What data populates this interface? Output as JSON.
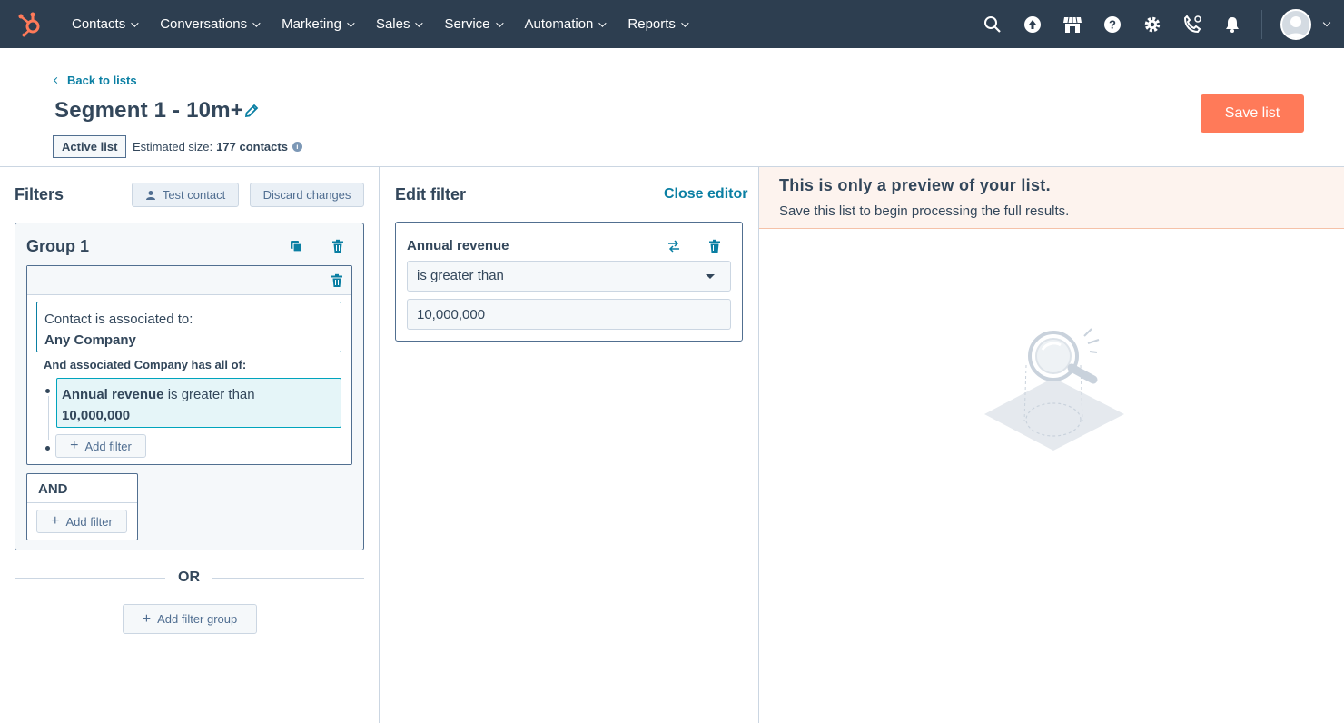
{
  "nav": {
    "items": [
      "Contacts",
      "Conversations",
      "Marketing",
      "Sales",
      "Service",
      "Automation",
      "Reports"
    ],
    "colors": {
      "bg": "#2d3e50",
      "accent": "#ff7a59"
    }
  },
  "header": {
    "back_label": "Back to lists",
    "title": "Segment 1 - 10m+",
    "save_label": "Save list",
    "tag_label": "Active list",
    "estimate_label": "Estimated size:",
    "estimate_value": "177 contacts"
  },
  "filters": {
    "heading": "Filters",
    "test_contact_label": "Test contact",
    "discard_label": "Discard changes",
    "group": {
      "title": "Group 1",
      "assoc_line1": "Contact is associated to:",
      "assoc_line2": "Any Company",
      "and_assoc_text": "And associated Company has all of:",
      "rule_property": "Annual revenue",
      "rule_operator": "is greater than",
      "rule_value": "10,000,000",
      "add_filter_label": "Add filter"
    },
    "and_box": {
      "title": "AND",
      "add_filter_label": "Add filter"
    },
    "or_label": "OR",
    "add_group_label": "Add filter group"
  },
  "editor": {
    "heading": "Edit filter",
    "close_label": "Close editor",
    "property": "Annual revenue",
    "operator": "is greater than",
    "value": "10,000,000"
  },
  "preview": {
    "title": "This is only a preview of your list.",
    "subtitle": "Save this list to begin processing the full results."
  }
}
